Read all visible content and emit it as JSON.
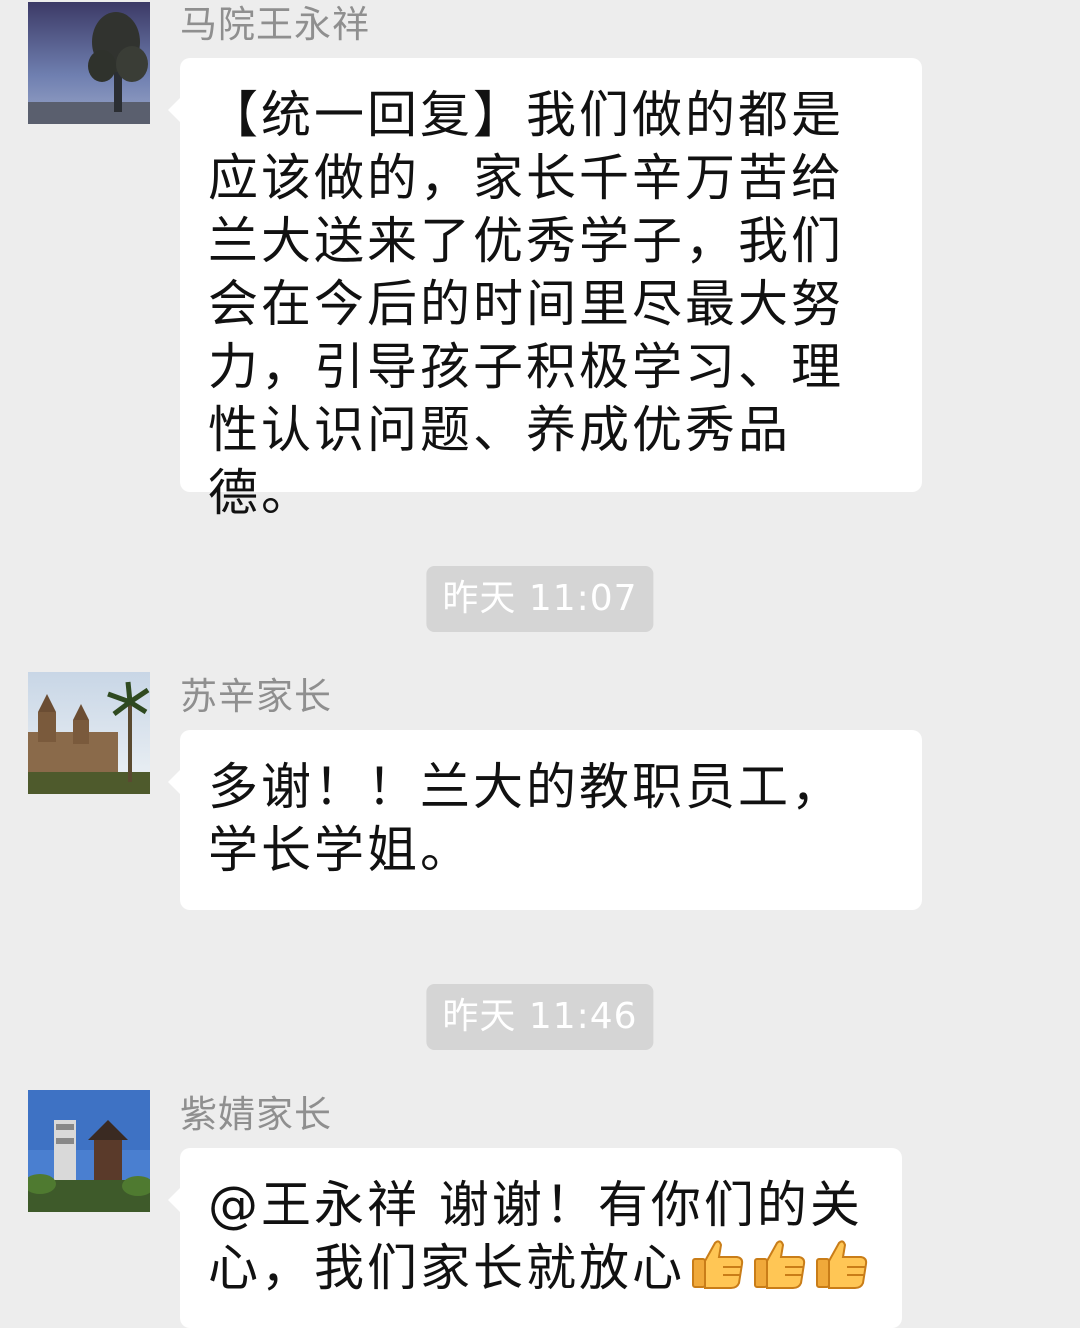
{
  "messages": [
    {
      "sender": "马院王永祥",
      "text": "【统一回复】我们做的都是应该做的，家长千辛万苦给兰大送来了优秀学子，我们会在今后的时间里尽最大努力，引导孩子积极学习、理性认识问题、养成优秀品德。"
    },
    {
      "time": "昨天 11:07"
    },
    {
      "sender": "苏辛家长",
      "text": "多谢！！兰大的教职员工，学长学姐。"
    },
    {
      "time": "昨天 11:46"
    },
    {
      "sender": "紫婧家长",
      "text": "@王永祥 谢谢！有你们的关心，我们家长就放心",
      "emoji": [
        "thumbs-up-icon",
        "thumbs-up-icon",
        "thumbs-up-icon"
      ]
    }
  ],
  "colors": {
    "background": "#ededed",
    "bubble": "#ffffff",
    "sender_name": "#8f8f8f",
    "timestamp_bg": "#d5d5d5",
    "timestamp_text": "#ffffff"
  }
}
